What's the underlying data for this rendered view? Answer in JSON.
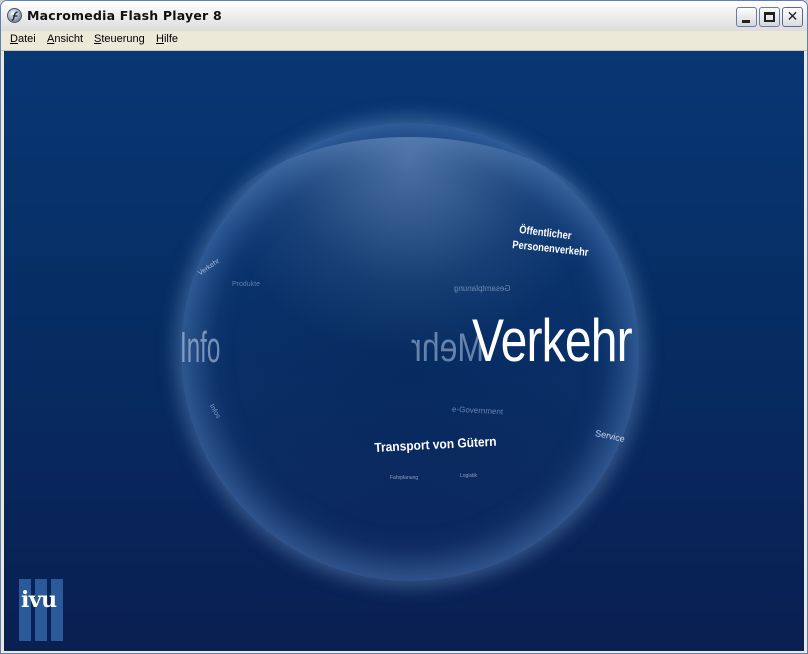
{
  "window": {
    "title": "Macromedia Flash Player 8",
    "icon": "flash-player-icon",
    "controls": {
      "minimize": "minimize-icon",
      "maximize": "maximize-icon",
      "close": "close-icon"
    }
  },
  "menubar": {
    "items": [
      {
        "label": "Datei",
        "accel": "D",
        "rest": "atei"
      },
      {
        "label": "Ansicht",
        "accel": "A",
        "rest": "nsicht"
      },
      {
        "label": "Steuerung",
        "accel": "S",
        "rest": "teuerung"
      },
      {
        "label": "Hilfe",
        "accel": "H",
        "rest": "ilfe"
      }
    ]
  },
  "stage": {
    "background_color": "#07306a",
    "sphere_words": {
      "main": "Verkehr",
      "mirror_main": "Mehr",
      "mirror_left": "Info",
      "oeffentlicher_line1": "Öffentlicher",
      "oeffentlicher_line2": "Personenverkehr",
      "transport": "Transport von Gütern",
      "egovernment": "e-Government",
      "gesamt": "Gesamtplanung",
      "service": "Service",
      "small1": "Fahrplanung",
      "small2": "Logistik",
      "left1": "Verkehr",
      "left2": "Produkte",
      "left3": "Infos"
    },
    "logo": {
      "text": "ivu",
      "color": "#2a5a9a"
    }
  }
}
